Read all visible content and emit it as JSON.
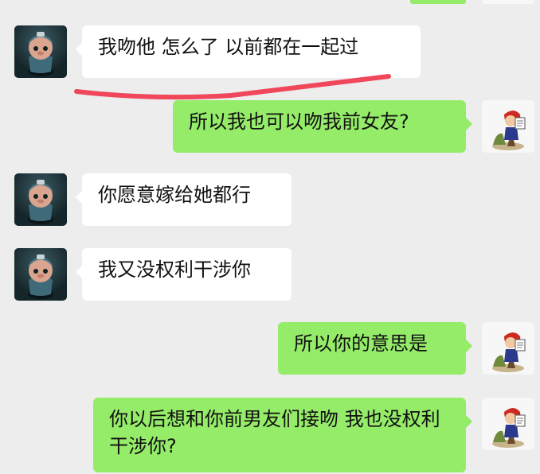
{
  "colors": {
    "background": "#ededed",
    "incoming_bubble": "#ffffff",
    "outgoing_bubble": "#95ec69",
    "annotation_underline": "#f0475a"
  },
  "messages": [
    {
      "side": "left",
      "text": "我吻他 怎么了 以前都在一起过"
    },
    {
      "side": "right",
      "text": "所以我也可以吻我前女友?"
    },
    {
      "side": "left",
      "text": "你愿意嫁给她都行"
    },
    {
      "side": "left",
      "text": "我又没权利干涉你"
    },
    {
      "side": "right",
      "text": "所以你的意思是"
    },
    {
      "side": "right",
      "text": "你以后想和你前男友们接吻 我也没权利干涉你?"
    }
  ],
  "avatars": {
    "left": "cartoon-character-avatar",
    "right": "cartoon-figure-avatar"
  }
}
